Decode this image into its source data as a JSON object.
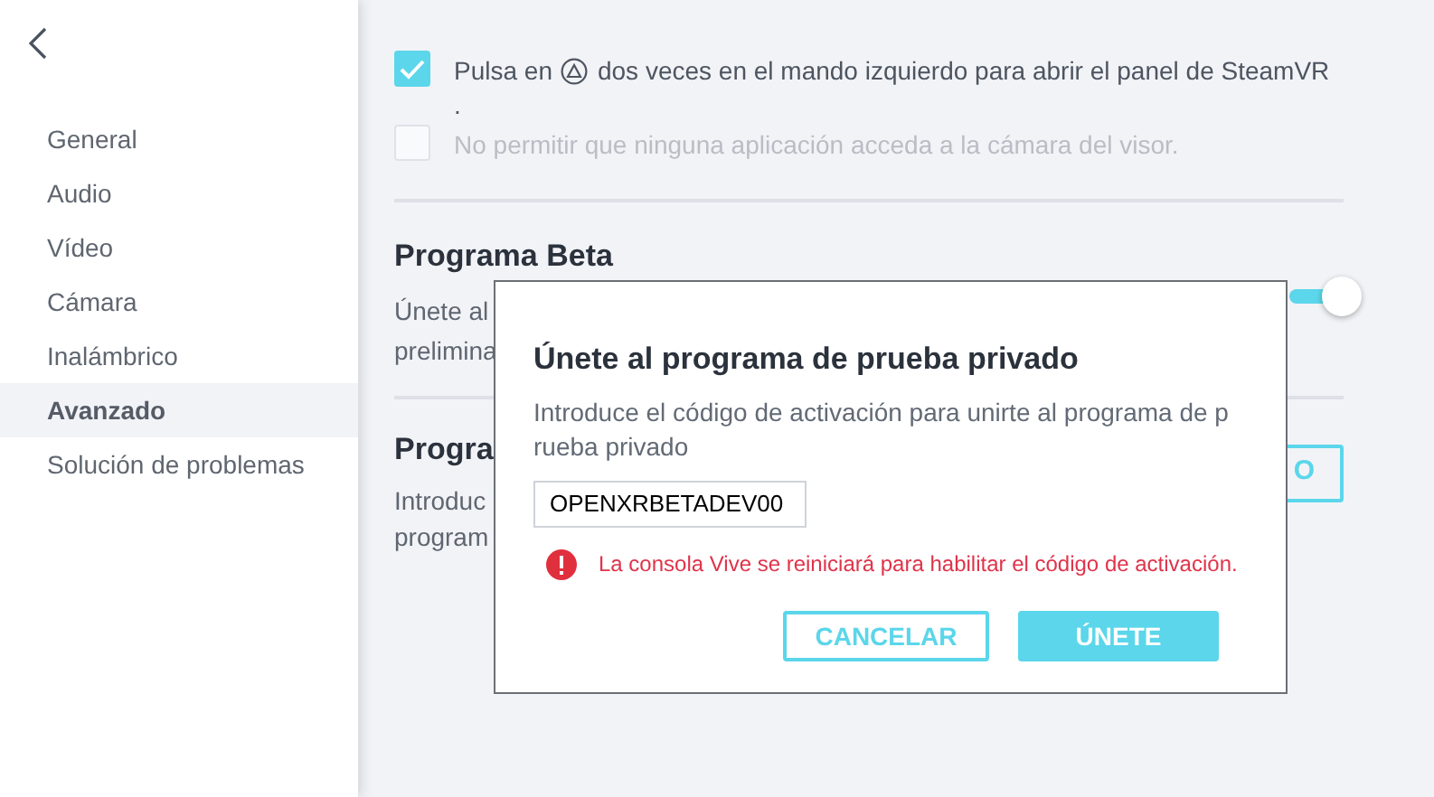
{
  "sidebar": {
    "items": [
      {
        "label": "General",
        "selected": false
      },
      {
        "label": "Audio",
        "selected": false
      },
      {
        "label": "Vídeo",
        "selected": false
      },
      {
        "label": "Cámara",
        "selected": false
      },
      {
        "label": "Inalámbrico",
        "selected": false
      },
      {
        "label": "Avanzado",
        "selected": true
      },
      {
        "label": "Solución de problemas",
        "selected": false
      }
    ]
  },
  "options": [
    {
      "text_before": "Pulsa en",
      "text_after": "dos veces en el mando izquierdo para abrir el panel de SteamVR",
      "trailing": ".",
      "checked": true,
      "disabled": false
    },
    {
      "text_before": "No permitir que ninguna aplicación acceda a la cámara del visor.",
      "checked": false,
      "disabled": true
    }
  ],
  "beta_section": {
    "title": "Programa Beta",
    "lines": [
      "Únete al",
      "prelimina"
    ],
    "switch_on": true
  },
  "code_section": {
    "title": "Progra",
    "lines": [
      "Introduc",
      "program"
    ],
    "button": "O"
  },
  "dialog": {
    "title": "Únete al programa de prueba privado",
    "description": [
      "Introduce el código de activación para unirte al programa de p",
      "rueba privado"
    ],
    "code_value": "OPENXRBETADEV00",
    "warning": "La consola Vive se reiniciará para habilitar el código de activación.",
    "cancel": "CANCELAR",
    "confirm": "ÚNETE"
  }
}
